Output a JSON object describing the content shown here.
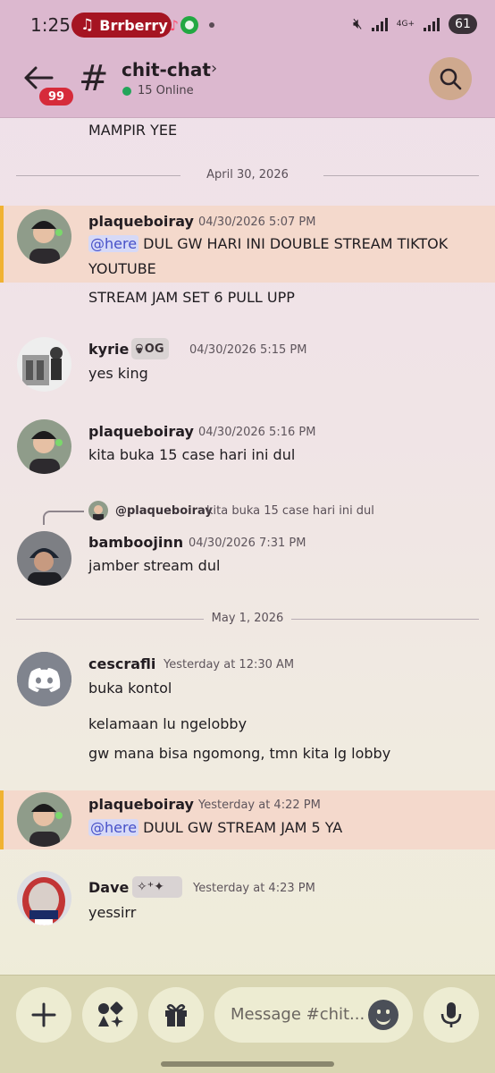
{
  "status_bar": {
    "time": "1:25",
    "media_pill": "Brrberry",
    "battery": "61",
    "network": "4G+"
  },
  "header": {
    "unread_count": "99",
    "channel_name": "chit-chat",
    "online": "15 Online"
  },
  "chat": {
    "prev_tail": "MAMPIR YEE",
    "divider_1": "April 30, 2026",
    "divider_2": "May 1, 2026",
    "mention": "@here",
    "messages": [
      {
        "username": "plaqueboiray",
        "timestamp": "04/30/2026 5:07 PM",
        "line1": "DUL GW HARI INI DOUBLE STREAM TIKTOK",
        "line2": "YOUTUBE",
        "line3": "STREAM JAM SET 6 PULL UPP"
      },
      {
        "username": "kyrie",
        "tag": "OG",
        "timestamp": "04/30/2026 5:15 PM",
        "line1": "yes king"
      },
      {
        "username": "plaqueboiray",
        "timestamp": "04/30/2026 5:16 PM",
        "line1": "kita buka 15 case hari ini dul"
      },
      {
        "reply_to": "@plaqueboiray",
        "reply_text": "kita buka 15 case hari ini dul",
        "username": "bamboojinn",
        "timestamp": "04/30/2026 7:31 PM",
        "line1": "jamber stream dul"
      },
      {
        "username": "cescrafli",
        "timestamp": "Yesterday at 12:30 AM",
        "line1": "buka kontol",
        "line2": "kelamaan lu ngelobby",
        "line3": "gw mana bisa ngomong, tmn kita lg lobby"
      },
      {
        "username": "plaqueboiray",
        "timestamp": "Yesterday at 4:22 PM",
        "line1": "DUUL GW STREAM JAM 5 YA"
      },
      {
        "username": "Dave",
        "timestamp": "Yesterday at 4:23 PM",
        "line1": "yessirr"
      }
    ]
  },
  "composer": {
    "placeholder": "Message #chit..."
  },
  "colors": {
    "header_bg": "#dcb8cf",
    "highlight_bg": "#f4d9cc",
    "highlight_border": "#f0b232",
    "mention_text": "#4650c8",
    "discord_blurple": "#5865f2",
    "composer_bg": "#d9d6b2"
  }
}
